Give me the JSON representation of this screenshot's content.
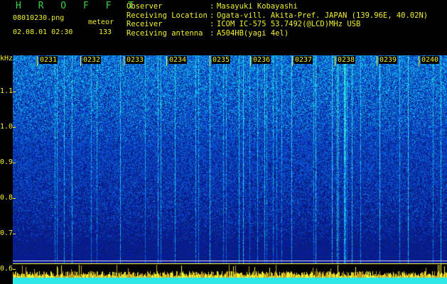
{
  "header": {
    "brand": "H R O F F T",
    "filename": "08010230.png",
    "meteor_label": "meteor",
    "datetime": "02.08.01 02:30",
    "meteor_count": "133"
  },
  "station_info": [
    {
      "label": "Observer",
      "value": "Masayuki Kobayashi"
    },
    {
      "label": "Receiving Location",
      "value": "Ogata-vill. Akita-Pref. JAPAN (139.96E, 40.02N)"
    },
    {
      "label": "Receiver",
      "value": "ICOM IC-575 53.7492(@LCD)MHz USB"
    },
    {
      "label": "Receiving antenna",
      "value": "A504HB(yagi 4el)"
    }
  ],
  "y_axis": {
    "unit": "kHz",
    "ticks": [
      "1.1",
      "1.0",
      "0.9",
      "0.8",
      "0.7",
      "0.6"
    ]
  },
  "time_axis": {
    "labels": [
      "0231",
      "0232",
      "0233",
      "0234",
      "0235",
      "0236",
      "0237",
      "0238",
      "0239",
      "0240"
    ]
  },
  "colors": {
    "text": "#f0f030",
    "brand": "#3ad34a",
    "background": "#000000",
    "spectrum_low": "#0b1f9c",
    "spectrum_high": "#2ee8e8"
  }
}
